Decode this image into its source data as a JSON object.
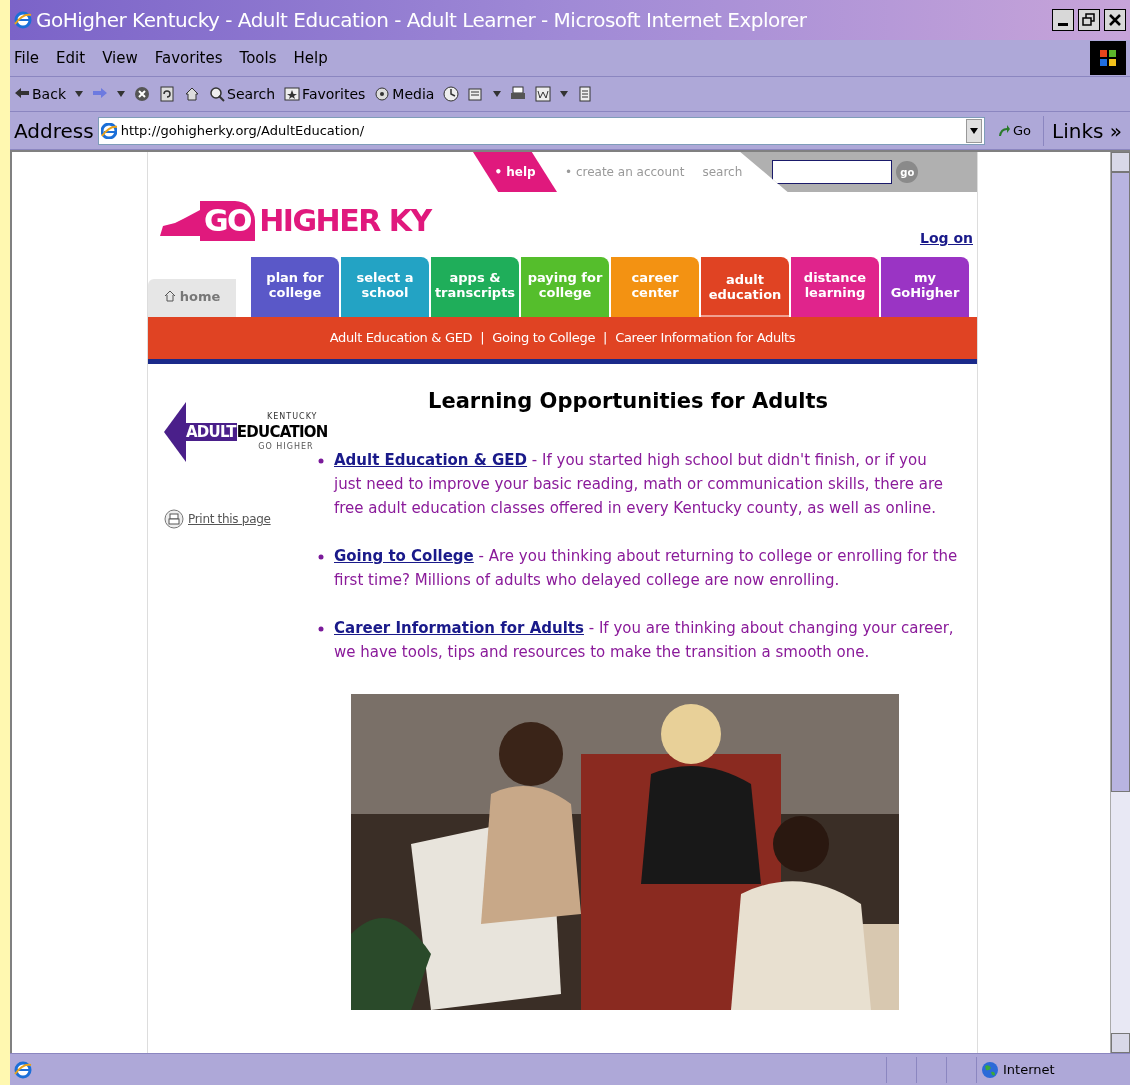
{
  "window": {
    "title": "GoHigher Kentucky - Adult Education - Adult Learner - Microsoft Internet Explorer"
  },
  "menu": [
    "File",
    "Edit",
    "View",
    "Favorites",
    "Tools",
    "Help"
  ],
  "toolbar": [
    {
      "kind": "back",
      "label": "Back"
    },
    {
      "kind": "forward"
    },
    {
      "kind": "stop"
    },
    {
      "kind": "refresh"
    },
    {
      "kind": "home"
    },
    {
      "kind": "search",
      "label": "Search"
    },
    {
      "kind": "favorites",
      "label": "Favorites"
    },
    {
      "kind": "media",
      "label": "Media"
    },
    {
      "kind": "history"
    },
    {
      "kind": "mail"
    },
    {
      "kind": "print"
    },
    {
      "kind": "edit"
    },
    {
      "kind": "discuss"
    }
  ],
  "address": {
    "label": "Address",
    "url": "http://gohigherky.org/AdultEducation/",
    "go": "Go",
    "links": "Links »"
  },
  "top_nav": {
    "help": "• help",
    "account": "• create an account",
    "search_label": "search",
    "go": "go"
  },
  "logo": {
    "go": "GO",
    "rest": "HIGHER KY"
  },
  "log_on": "Log on",
  "tabs": [
    {
      "lines": [
        "home"
      ],
      "color": "#e6e6e6",
      "selected": false
    },
    {
      "lines": [
        "plan for",
        "college"
      ],
      "color": "#5a58c8",
      "selected": false
    },
    {
      "lines": [
        "select a",
        "school"
      ],
      "color": "#23a3c4",
      "selected": false
    },
    {
      "lines": [
        "apps &",
        "transcripts"
      ],
      "color": "#1fae5a",
      "selected": false
    },
    {
      "lines": [
        "paying for",
        "college"
      ],
      "color": "#55be2c",
      "selected": false
    },
    {
      "lines": [
        "career",
        "center"
      ],
      "color": "#f39212",
      "selected": false
    },
    {
      "lines": [
        "adult",
        "education"
      ],
      "color": "#e04323",
      "selected": true
    },
    {
      "lines": [
        "distance",
        "learning"
      ],
      "color": "#e0248c",
      "selected": false
    },
    {
      "lines": [
        "my",
        "GoHigher"
      ],
      "color": "#9a34c4",
      "selected": false
    }
  ],
  "subnav": [
    "Adult Education & GED",
    "Going to College",
    "Career Information for Adults"
  ],
  "subnav_separator": "|",
  "side_logo": {
    "top": "KENTUCKY",
    "left": "ADULT",
    "right": "EDUCATION",
    "bottom": "GO HIGHER"
  },
  "print": "Print this page",
  "heading": "Learning Opportunities for Adults",
  "items": [
    {
      "link": "Adult Education & GED",
      "text": " - If you started high school but didn't finish, or if you just need to improve your basic reading, math or communication skills, there are free adult education classes offered in every Kentucky county, as well as online."
    },
    {
      "link": "Going to College",
      "text": " - Are you thinking about returning to college or enrolling for the first time? Millions of adults who delayed college are now enrolling."
    },
    {
      "link": "Career Information for Adults",
      "text": " - If you are thinking about changing your career, we have tools, tips and resources to make the transition a smooth one."
    }
  ],
  "status_bar": {
    "zone": "Internet"
  }
}
